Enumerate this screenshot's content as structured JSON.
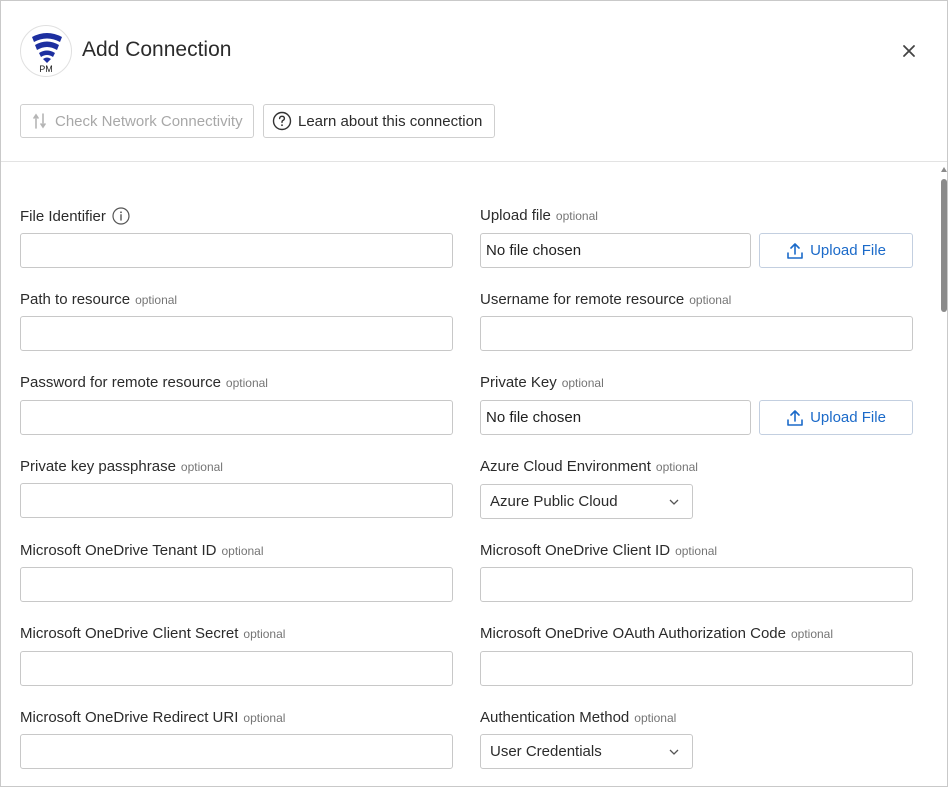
{
  "header": {
    "logo_text": "PM",
    "title": "Add Connection"
  },
  "toolbar": {
    "check_label": "Check Network Connectivity",
    "learn_label": "Learn about this connection"
  },
  "optional_tag": "optional",
  "fields": {
    "file_identifier": {
      "label": "File Identifier",
      "value": ""
    },
    "upload_file": {
      "label": "Upload file",
      "status": "No file chosen",
      "button": "Upload File"
    },
    "path_to_resource": {
      "label": "Path to resource",
      "value": ""
    },
    "username_remote": {
      "label": "Username for remote resource",
      "value": ""
    },
    "password_remote": {
      "label": "Password for remote resource",
      "value": ""
    },
    "private_key": {
      "label": "Private Key",
      "status": "No file chosen",
      "button": "Upload File"
    },
    "private_key_passphrase": {
      "label": "Private key passphrase",
      "value": ""
    },
    "azure_env": {
      "label": "Azure Cloud Environment",
      "selected": "Azure Public Cloud"
    },
    "onedrive_tenant": {
      "label": "Microsoft OneDrive Tenant ID",
      "value": ""
    },
    "onedrive_client_id": {
      "label": "Microsoft OneDrive Client ID",
      "value": ""
    },
    "onedrive_client_secret": {
      "label": "Microsoft OneDrive Client Secret",
      "value": ""
    },
    "onedrive_oauth_code": {
      "label": "Microsoft OneDrive OAuth Authorization Code",
      "value": ""
    },
    "onedrive_redirect_uri": {
      "label": "Microsoft OneDrive Redirect URI",
      "value": ""
    },
    "auth_method": {
      "label": "Authentication Method",
      "selected": "User Credentials"
    }
  },
  "colors": {
    "accent": "#1b6ac9",
    "logo_blue": "#1d2fa0",
    "border": "#c8c8c8"
  }
}
